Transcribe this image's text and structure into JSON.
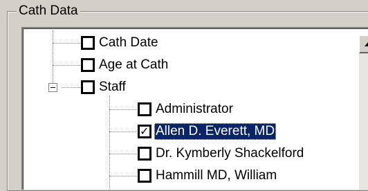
{
  "group": {
    "title": "Cath Data"
  },
  "tree": {
    "items": [
      {
        "label": "Cath Date",
        "checked": false
      },
      {
        "label": "Age at Cath",
        "checked": false
      },
      {
        "label": "Staff",
        "checked": false,
        "expanded": true
      },
      {
        "label": "Administrator",
        "checked": false
      },
      {
        "label": "Allen D. Everett, MD",
        "checked": true,
        "selected": true
      },
      {
        "label": "Dr. Kymberly Shackelford",
        "checked": false
      },
      {
        "label": "Hammill MD, William",
        "checked": false
      }
    ]
  },
  "scrollbar": {
    "up_icon": "arrow-up-icon"
  }
}
